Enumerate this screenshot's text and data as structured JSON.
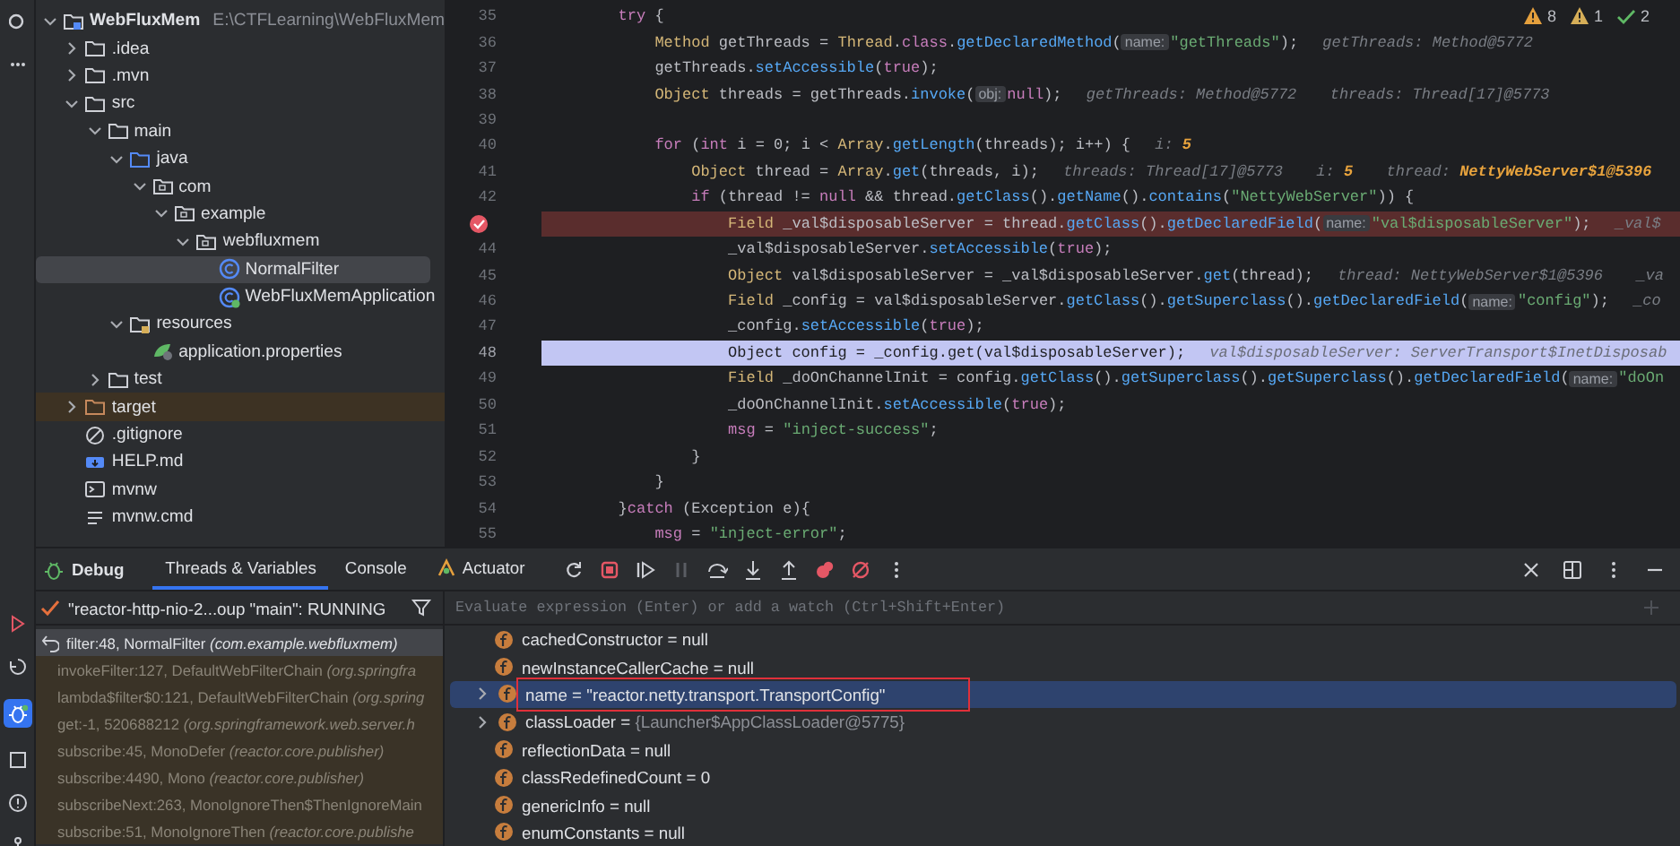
{
  "project": {
    "name": "WebFluxMem",
    "path": "E:\\CTFLearning\\WebFluxMem",
    "expanded": true,
    "selected": false,
    "children": [
      {
        "label": ".idea",
        "kind": "folder",
        "expanded": false,
        "selected": false
      },
      {
        "label": ".mvn",
        "kind": "folder",
        "expanded": false,
        "selected": false
      },
      {
        "label": "src",
        "kind": "folder",
        "expanded": true,
        "selected": false,
        "children": [
          {
            "label": "main",
            "kind": "folder",
            "expanded": true,
            "selected": false,
            "children": [
              {
                "label": "java",
                "kind": "source-root",
                "expanded": true,
                "selected": false,
                "children": [
                  {
                    "label": "com",
                    "kind": "package",
                    "expanded": true,
                    "selected": false,
                    "children": [
                      {
                        "label": "example",
                        "kind": "package",
                        "expanded": true,
                        "selected": false,
                        "children": [
                          {
                            "label": "webfluxmem",
                            "kind": "package",
                            "expanded": true,
                            "selected": false,
                            "children": [
                              {
                                "label": "NormalFilter",
                                "kind": "class",
                                "selected": true
                              },
                              {
                                "label": "WebFluxMemApplication",
                                "kind": "spring-class",
                                "selected": false
                              }
                            ]
                          }
                        ]
                      }
                    ]
                  }
                ]
              },
              {
                "label": "resources",
                "kind": "resources-root",
                "expanded": true,
                "selected": false,
                "children": [
                  {
                    "label": "application.properties",
                    "kind": "properties",
                    "selected": false
                  }
                ]
              }
            ]
          },
          {
            "label": "test",
            "kind": "folder",
            "expanded": false,
            "selected": false
          }
        ]
      },
      {
        "label": "target",
        "kind": "excluded-folder",
        "expanded": false,
        "selected": false
      },
      {
        "label": ".gitignore",
        "kind": "gitignore",
        "selected": false
      },
      {
        "label": "HELP.md",
        "kind": "markdown",
        "selected": false
      },
      {
        "label": "mvnw",
        "kind": "shell",
        "selected": false
      },
      {
        "label": "mvnw.cmd",
        "kind": "text",
        "selected": false
      }
    ]
  },
  "editor": {
    "inspections": [
      {
        "kind": "warning",
        "count": "8"
      },
      {
        "kind": "weak-warning",
        "count": "1"
      },
      {
        "kind": "typo",
        "count": "2"
      }
    ],
    "lines": [
      {
        "number": "35",
        "breakpoint": false,
        "current": false,
        "tokens": [
          {
            "kind": "keyword",
            "text": "        try"
          },
          {
            "kind": "plain",
            "text": " {"
          }
        ]
      },
      {
        "number": "36",
        "breakpoint": false,
        "current": false,
        "tokens": [
          {
            "kind": "type",
            "text": "            Method"
          },
          {
            "kind": "plain",
            "text": " getThreads = "
          },
          {
            "kind": "type",
            "text": "Thread"
          },
          {
            "kind": "plain",
            "text": "."
          },
          {
            "kind": "keyword",
            "text": "class"
          },
          {
            "kind": "plain",
            "text": "."
          },
          {
            "kind": "method",
            "text": "getDeclaredMethod"
          },
          {
            "kind": "plain",
            "text": "("
          },
          {
            "kind": "param",
            "text": "name:"
          },
          {
            "kind": "string",
            "text": "\"getThreads\""
          },
          {
            "kind": "plain",
            "text": ");"
          },
          {
            "kind": "hint",
            "text": "getThreads: Method@5772"
          }
        ]
      },
      {
        "number": "37",
        "breakpoint": false,
        "current": false,
        "tokens": [
          {
            "kind": "plain",
            "text": "            getThreads."
          },
          {
            "kind": "method",
            "text": "setAccessible"
          },
          {
            "kind": "plain",
            "text": "("
          },
          {
            "kind": "keyword",
            "text": "true"
          },
          {
            "kind": "plain",
            "text": ");"
          }
        ]
      },
      {
        "number": "38",
        "breakpoint": false,
        "current": false,
        "tokens": [
          {
            "kind": "type",
            "text": "            Object"
          },
          {
            "kind": "plain",
            "text": " threads = getThreads."
          },
          {
            "kind": "method",
            "text": "invoke"
          },
          {
            "kind": "plain",
            "text": "("
          },
          {
            "kind": "param",
            "text": "obj:"
          },
          {
            "kind": "keyword",
            "text": "null"
          },
          {
            "kind": "plain",
            "text": ");"
          },
          {
            "kind": "hint",
            "text": "getThreads: Method@5772"
          },
          {
            "kind": "hint",
            "text": "threads: Thread[17]@5773"
          }
        ]
      },
      {
        "number": "39",
        "breakpoint": false,
        "current": false
      },
      {
        "number": "40",
        "breakpoint": false,
        "current": false,
        "tokens": [
          {
            "kind": "keyword",
            "text": "            for"
          },
          {
            "kind": "plain",
            "text": " ("
          },
          {
            "kind": "keyword",
            "text": "int"
          },
          {
            "kind": "plain",
            "text": " i = 0; i < "
          },
          {
            "kind": "type",
            "text": "Array"
          },
          {
            "kind": "plain",
            "text": "."
          },
          {
            "kind": "method",
            "text": "getLength"
          },
          {
            "kind": "plain",
            "text": "(threads); i++) {"
          },
          {
            "kind": "hint",
            "text": "i:"
          },
          {
            "kind": "hint-value",
            "text": "5"
          }
        ]
      },
      {
        "number": "41",
        "breakpoint": false,
        "current": false,
        "tokens": [
          {
            "kind": "type",
            "text": "                Object"
          },
          {
            "kind": "plain",
            "text": " thread = "
          },
          {
            "kind": "type",
            "text": "Array"
          },
          {
            "kind": "plain",
            "text": "."
          },
          {
            "kind": "method",
            "text": "get"
          },
          {
            "kind": "plain",
            "text": "(threads, i);"
          },
          {
            "kind": "hint",
            "text": "threads: Thread[17]@5773"
          },
          {
            "kind": "hint",
            "text": "i:"
          },
          {
            "kind": "hint-value",
            "text": "5"
          },
          {
            "kind": "hint",
            "text": "thread:"
          },
          {
            "kind": "hint-value",
            "text": "NettyWebServer$1@5396"
          }
        ]
      },
      {
        "number": "42",
        "breakpoint": false,
        "current": false,
        "tokens": [
          {
            "kind": "keyword",
            "text": "                if"
          },
          {
            "kind": "plain",
            "text": " (thread != "
          },
          {
            "kind": "keyword",
            "text": "null"
          },
          {
            "kind": "plain",
            "text": " && thread."
          },
          {
            "kind": "method",
            "text": "getClass"
          },
          {
            "kind": "plain",
            "text": "()."
          },
          {
            "kind": "method",
            "text": "getName"
          },
          {
            "kind": "plain",
            "text": "()."
          },
          {
            "kind": "method",
            "text": "contains"
          },
          {
            "kind": "plain",
            "text": "("
          },
          {
            "kind": "string",
            "text": "\"NettyWebServer\""
          },
          {
            "kind": "plain",
            "text": ")) {"
          }
        ]
      },
      {
        "breakpoint": true,
        "current": false,
        "tokens": [
          {
            "kind": "type",
            "text": "                    Field"
          },
          {
            "kind": "plain",
            "text": " _val$disposableServer = thread."
          },
          {
            "kind": "method",
            "text": "getClass"
          },
          {
            "kind": "plain",
            "text": "()."
          },
          {
            "kind": "method",
            "text": "getDeclaredField"
          },
          {
            "kind": "plain",
            "text": "("
          },
          {
            "kind": "param",
            "text": "name:"
          },
          {
            "kind": "string",
            "text": "\"val$disposableServer\""
          },
          {
            "kind": "plain",
            "text": ");"
          },
          {
            "kind": "hint",
            "text": "_val$"
          }
        ]
      },
      {
        "number": "44",
        "breakpoint": false,
        "current": false,
        "tokens": [
          {
            "kind": "plain",
            "text": "                    _val$disposableServer."
          },
          {
            "kind": "method",
            "text": "setAccessible"
          },
          {
            "kind": "plain",
            "text": "("
          },
          {
            "kind": "keyword",
            "text": "true"
          },
          {
            "kind": "plain",
            "text": ");"
          }
        ]
      },
      {
        "number": "45",
        "breakpoint": false,
        "current": false,
        "tokens": [
          {
            "kind": "type",
            "text": "                    Object"
          },
          {
            "kind": "plain",
            "text": " val$disposableServer = _val$disposableServer."
          },
          {
            "kind": "method",
            "text": "get"
          },
          {
            "kind": "plain",
            "text": "(thread);"
          },
          {
            "kind": "hint",
            "text": "thread: NettyWebServer$1@5396"
          },
          {
            "kind": "hint",
            "text": "_va"
          }
        ]
      },
      {
        "number": "46",
        "breakpoint": false,
        "current": false,
        "tokens": [
          {
            "kind": "type",
            "text": "                    Field"
          },
          {
            "kind": "plain",
            "text": " _config = val$disposableServer."
          },
          {
            "kind": "method",
            "text": "getClass"
          },
          {
            "kind": "plain",
            "text": "()."
          },
          {
            "kind": "method",
            "text": "getSuperclass"
          },
          {
            "kind": "plain",
            "text": "()."
          },
          {
            "kind": "method",
            "text": "getDeclaredField"
          },
          {
            "kind": "plain",
            "text": "("
          },
          {
            "kind": "param",
            "text": "name:"
          },
          {
            "kind": "string",
            "text": "\"config\""
          },
          {
            "kind": "plain",
            "text": ");"
          },
          {
            "kind": "hint",
            "text": "_co"
          }
        ]
      },
      {
        "number": "47",
        "breakpoint": false,
        "current": false,
        "tokens": [
          {
            "kind": "plain",
            "text": "                    _config."
          },
          {
            "kind": "method",
            "text": "setAccessible"
          },
          {
            "kind": "plain",
            "text": "("
          },
          {
            "kind": "keyword",
            "text": "true"
          },
          {
            "kind": "plain",
            "text": ");"
          }
        ]
      },
      {
        "number": "48",
        "breakpoint": false,
        "current": true,
        "tokens": [
          {
            "kind": "type",
            "text": "                    Object"
          },
          {
            "kind": "plain",
            "text": " config = _config."
          },
          {
            "kind": "method",
            "text": "get"
          },
          {
            "kind": "plain",
            "text": "(val$disposableServer);"
          },
          {
            "kind": "hint",
            "text": "val$disposableServer: ServerTransport$InetDisposab"
          }
        ]
      },
      {
        "number": "49",
        "breakpoint": false,
        "current": false,
        "tokens": [
          {
            "kind": "type",
            "text": "                    Field"
          },
          {
            "kind": "plain",
            "text": " _doOnChannelInit = config."
          },
          {
            "kind": "method",
            "text": "getClass"
          },
          {
            "kind": "plain",
            "text": "()."
          },
          {
            "kind": "method",
            "text": "getSuperclass"
          },
          {
            "kind": "plain",
            "text": "()."
          },
          {
            "kind": "method",
            "text": "getSuperclass"
          },
          {
            "kind": "plain",
            "text": "()."
          },
          {
            "kind": "method",
            "text": "getDeclaredField"
          },
          {
            "kind": "plain",
            "text": "("
          },
          {
            "kind": "param",
            "text": "name:"
          },
          {
            "kind": "string",
            "text": "\"doOn"
          }
        ]
      },
      {
        "number": "50",
        "breakpoint": false,
        "current": false,
        "tokens": [
          {
            "kind": "plain",
            "text": "                    _doOnChannelInit."
          },
          {
            "kind": "method",
            "text": "setAccessible"
          },
          {
            "kind": "plain",
            "text": "("
          },
          {
            "kind": "keyword",
            "text": "true"
          },
          {
            "kind": "plain",
            "text": ");"
          }
        ]
      },
      {
        "number": "51",
        "breakpoint": false,
        "current": false,
        "tokens": [
          {
            "kind": "field",
            "text": "                    msg"
          },
          {
            "kind": "plain",
            "text": " = "
          },
          {
            "kind": "string",
            "text": "\"inject-success\""
          },
          {
            "kind": "plain",
            "text": ";"
          }
        ]
      },
      {
        "number": "52",
        "breakpoint": false,
        "current": false,
        "tokens": [
          {
            "kind": "plain",
            "text": "                }"
          }
        ]
      },
      {
        "number": "53",
        "breakpoint": false,
        "current": false,
        "tokens": [
          {
            "kind": "plain",
            "text": "            }"
          }
        ]
      },
      {
        "number": "54",
        "breakpoint": false,
        "current": false,
        "tokens": [
          {
            "kind": "plain",
            "text": "        }"
          },
          {
            "kind": "keyword",
            "text": "catch"
          },
          {
            "kind": "plain",
            "text": " (Exception e){"
          }
        ]
      },
      {
        "number": "55",
        "breakpoint": false,
        "current": false,
        "tokens": [
          {
            "kind": "field",
            "text": "            msg"
          },
          {
            "kind": "plain",
            "text": " = "
          },
          {
            "kind": "string",
            "text": "\"inject-error\""
          },
          {
            "kind": "plain",
            "text": ";"
          }
        ]
      }
    ]
  },
  "debug": {
    "title": "Debug",
    "tabs": [
      {
        "label": "Threads & Variables",
        "selected": true,
        "has_icon": false
      },
      {
        "label": "Console",
        "selected": false,
        "has_icon": false
      },
      {
        "label": "Actuator",
        "selected": false,
        "has_icon": true
      }
    ],
    "toolbar": [
      {
        "kind": "rerun",
        "disabled": false
      },
      {
        "kind": "stop",
        "disabled": false
      },
      {
        "kind": "resume",
        "disabled": false
      },
      {
        "kind": "pause",
        "disabled": true
      },
      {
        "kind": "step-over",
        "disabled": false
      },
      {
        "kind": "step-into",
        "disabled": false
      },
      {
        "kind": "step-out",
        "disabled": false
      },
      {
        "kind": "breakpoints",
        "disabled": false
      },
      {
        "kind": "mute-breakpoints",
        "disabled": false
      },
      {
        "kind": "more",
        "disabled": false
      }
    ],
    "window_controls": [
      {
        "kind": "close"
      },
      {
        "kind": "layout"
      },
      {
        "kind": "more"
      },
      {
        "kind": "minimize"
      }
    ],
    "thread": {
      "label": "\"reactor-http-nio-2...oup \"main\": RUNNING"
    },
    "evaluate": {
      "placeholder": "Evaluate expression (Enter) or add a watch (Ctrl+Shift+Enter)"
    },
    "frames": [
      {
        "text": "filter:48, NormalFilter *(com.example.webfluxmem)*",
        "selected": true,
        "library": false
      },
      {
        "text": "invokeFilter:127, DefaultWebFilterChain *(org.springfra*",
        "selected": false,
        "library": true
      },
      {
        "text": "lambda$filter$0:121, DefaultWebFilterChain *(org.spring*",
        "selected": false,
        "library": true
      },
      {
        "text": "get:-1, 520688212 *(org.springframework.web.server.h*",
        "selected": false,
        "library": true
      },
      {
        "text": "subscribe:45, MonoDefer *(reactor.core.publisher)*",
        "selected": false,
        "library": true
      },
      {
        "text": "subscribe:4490, Mono *(reactor.core.publisher)*",
        "selected": false,
        "library": true
      },
      {
        "text": "subscribeNext:263, MonoIgnoreThen$ThenIgnoreMain",
        "selected": false,
        "library": true
      },
      {
        "text": "subscribe:51, MonoIgnoreThen *(reactor.core.publishe*",
        "selected": false,
        "library": true
      }
    ],
    "variables": [
      {
        "name": "cachedConstructor",
        "operator": "=",
        "value": "null",
        "dimmed": false,
        "expandable": false,
        "selected": false,
        "annotated": false
      },
      {
        "name": "newInstanceCallerCache",
        "operator": "=",
        "value": "null",
        "dimmed": false,
        "expandable": false,
        "selected": false,
        "annotated": false
      },
      {
        "name": "name",
        "operator": "=",
        "value": "\"reactor.netty.transport.TransportConfig\"",
        "dimmed": false,
        "expandable": true,
        "selected": true,
        "annotated": true
      },
      {
        "name": "classLoader",
        "operator": "=",
        "value": "{Launcher$AppClassLoader@5775}",
        "dimmed": true,
        "expandable": true,
        "selected": false,
        "annotated": false
      },
      {
        "name": "reflectionData",
        "operator": "=",
        "value": "null",
        "dimmed": false,
        "expandable": false,
        "selected": false,
        "annotated": false
      },
      {
        "name": "classRedefinedCount",
        "operator": "=",
        "value": "0",
        "dimmed": false,
        "expandable": false,
        "selected": false,
        "annotated": false
      },
      {
        "name": "genericInfo",
        "operator": "=",
        "value": "null",
        "dimmed": false,
        "expandable": false,
        "selected": false,
        "annotated": false
      },
      {
        "name": "enumConstants",
        "operator": "=",
        "value": "null",
        "dimmed": false,
        "expandable": false,
        "selected": false,
        "annotated": false
      }
    ]
  }
}
